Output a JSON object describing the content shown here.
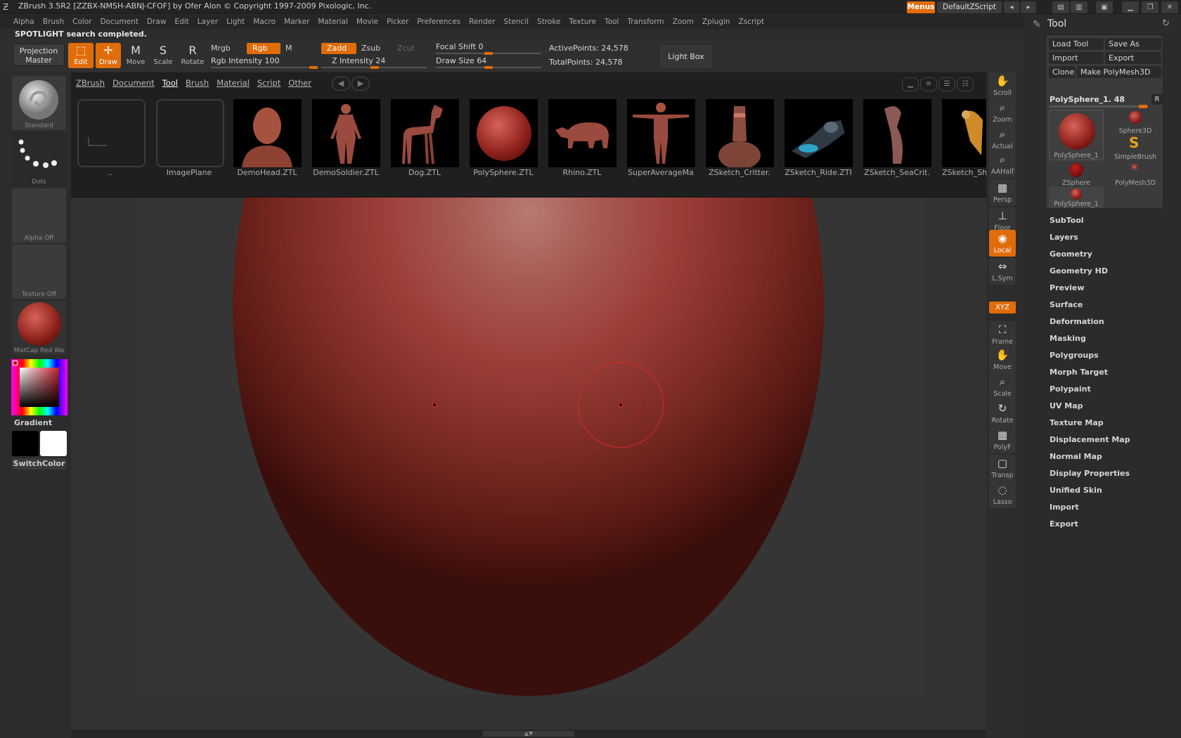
{
  "titlebar": {
    "title": "ZBrush 3.5R2 [ZZBX-NMSH-ABNJ-CFOF] by Ofer Alon © Copyright 1997-2009 Pixologic, Inc.",
    "menus_label": "Menus",
    "zscript_label": "DefaultZScript"
  },
  "menubar": [
    "Alpha",
    "Brush",
    "Color",
    "Document",
    "Draw",
    "Edit",
    "Layer",
    "Light",
    "Macro",
    "Marker",
    "Material",
    "Movie",
    "Picker",
    "Preferences",
    "Render",
    "Stencil",
    "Stroke",
    "Texture",
    "Tool",
    "Transform",
    "Zoom",
    "Zplugin",
    "Zscript"
  ],
  "notice": "SPOTLIGHT search completed.",
  "toolbar": {
    "projection_master": "Projection Master",
    "modes": [
      "Edit",
      "Draw",
      "Move",
      "Scale",
      "Rotate"
    ],
    "mode_glyphs": [
      "M",
      "S",
      "R"
    ],
    "mrgb": "Mrgb",
    "rgb": "Rgb",
    "m": "M",
    "zadd": "Zadd",
    "zsub": "Zsub",
    "zcut": "Zcut",
    "rgb_intensity_label": "Rgb Intensity",
    "rgb_intensity": "100",
    "z_intensity_label": "Z Intensity",
    "z_intensity": "24",
    "focal_shift_label": "Focal Shift",
    "focal_shift": "0",
    "draw_size_label": "Draw Size",
    "draw_size": "64",
    "active_points_label": "ActivePoints:",
    "active_points": "24,578",
    "total_points_label": "TotalPoints:",
    "total_points": "24,578",
    "light_box": "Light Box"
  },
  "left_shelf": {
    "brush": "Standard",
    "stroke": "Dots",
    "alpha": "Alpha Off",
    "texture": "Texture Off",
    "material": "MatCap Red Wa",
    "gradient": "Gradient",
    "switch_color": "SwitchColor"
  },
  "lightbox": {
    "tabs": [
      "ZBrush",
      "Document",
      "Tool",
      "Brush",
      "Material",
      "Script",
      "Other"
    ],
    "items": [
      "..",
      "ImagePlane",
      "DemoHead.ZTL",
      "DemoSoldier.ZTL",
      "Dog.ZTL",
      "PolySphere.ZTL",
      "Rhino.ZTL",
      "SuperAverageMa",
      "ZSketch_Critter.",
      "ZSketch_Ride.ZTI",
      "ZSketch_SeaCrit.",
      "ZSketch_Sh"
    ]
  },
  "right_shelf": {
    "buttons": [
      "Scroll",
      "Zoom",
      "Actual",
      "AAHalf",
      "Persp",
      "Floor",
      "Local",
      "L.Sym",
      "XYZ",
      "Frame",
      "Move",
      "Scale",
      "Rotate",
      "PolyF",
      "Transp",
      "Lasso"
    ]
  },
  "tool_panel": {
    "title": "Tool",
    "load_tool": "Load Tool",
    "save_as": "Save As",
    "import": "Import",
    "export": "Export",
    "clone": "Clone",
    "make_polymesh": "Make PolyMesh3D",
    "current_tool": "PolySphere_1. 48",
    "r_label": "R",
    "thumbs": [
      "PolySphere_1",
      "Sphere3D",
      "SimpleBrush",
      "ZSphere",
      "PolyMesh3D",
      "PolySphere_1"
    ],
    "menu": [
      "SubTool",
      "Layers",
      "Geometry",
      "Geometry HD",
      "Preview",
      "Surface",
      "Deformation",
      "Masking",
      "Polygroups",
      "Morph Target",
      "Polypaint",
      "UV Map",
      "Texture Map",
      "Displacement Map",
      "Normal Map",
      "Display Properties",
      "Unified Skin",
      "Import",
      "Export"
    ]
  },
  "colors": {
    "accent": "#e06c0a",
    "primary_color": "#000000",
    "secondary_color": "#ffffff",
    "sphere": "#9a3f38"
  }
}
